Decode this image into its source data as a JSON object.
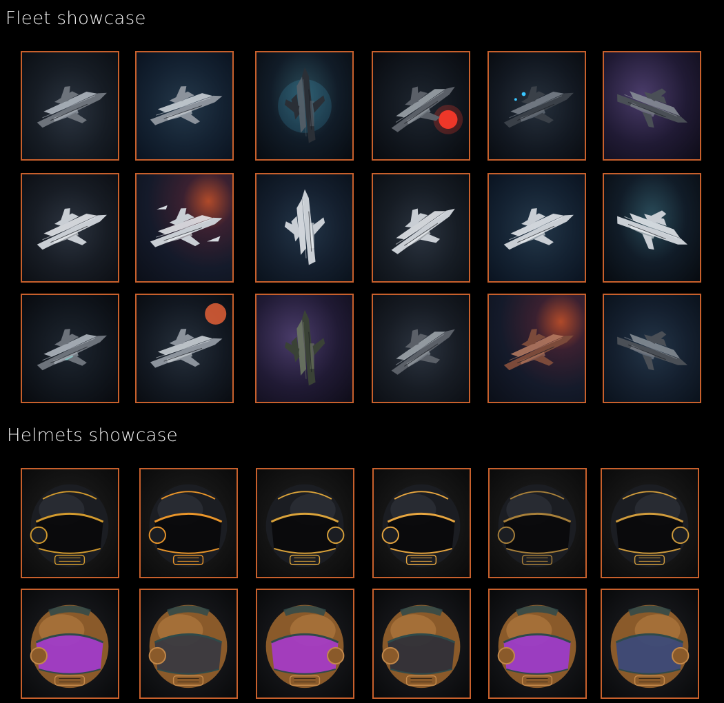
{
  "sections": {
    "fleet": {
      "title": "Fleet showcase"
    },
    "helmets": {
      "title": "Helmets showcase"
    }
  },
  "colors": {
    "background": "#000000",
    "card_border": "#c8602c",
    "title_text": "#f0f0f0"
  },
  "fleet_items": [
    {
      "icon": "spaceship-image",
      "palette": "gray",
      "accent": "#9aa3ad"
    },
    {
      "icon": "spaceship-image",
      "palette": "silver",
      "accent": "#c8ccd2"
    },
    {
      "icon": "spaceship-image",
      "palette": "dark",
      "accent": "#4fd0ff"
    },
    {
      "icon": "spaceship-image",
      "palette": "silver-red-engine",
      "accent": "#ff3a2a"
    },
    {
      "icon": "spaceship-image",
      "palette": "dark-blue-lights",
      "accent": "#39c6ff"
    },
    {
      "icon": "spaceship-image",
      "palette": "charcoal",
      "accent": "#6a717a"
    },
    {
      "icon": "spaceship-image",
      "palette": "white",
      "accent": "#dfe3e8"
    },
    {
      "icon": "spaceship-image",
      "palette": "white-escort",
      "accent": "#e8ecf0"
    },
    {
      "icon": "spaceship-image",
      "palette": "pale-blue-gold",
      "accent": "#c9a247"
    },
    {
      "icon": "spaceship-image",
      "palette": "white",
      "accent": "#e0e4e8"
    },
    {
      "icon": "spaceship-image",
      "palette": "white",
      "accent": "#d6dade"
    },
    {
      "icon": "spaceship-image",
      "palette": "pale-blue",
      "accent": "#cfd9e2"
    },
    {
      "icon": "spaceship-image",
      "palette": "dark-teal-glow",
      "accent": "#3ee0d0"
    },
    {
      "icon": "spaceship-image",
      "palette": "tan-sunset",
      "accent": "#ff6a3a"
    },
    {
      "icon": "spaceship-image",
      "palette": "green-dark",
      "accent": "#7c8a6c"
    },
    {
      "icon": "spaceship-image",
      "palette": "steel-blue",
      "accent": "#8ea2bb"
    },
    {
      "icon": "spaceship-image",
      "palette": "rust",
      "accent": "#a8644c"
    },
    {
      "icon": "spaceship-image",
      "palette": "charcoal",
      "accent": "#7d848c"
    }
  ],
  "helmet_items": [
    {
      "icon": "helmet-image",
      "palette": "black-gold",
      "accent": "#d29a2e"
    },
    {
      "icon": "helmet-image",
      "palette": "black-amber",
      "accent": "#e9952a"
    },
    {
      "icon": "helmet-image",
      "palette": "black-gold-stripes",
      "accent": "#d9a23a"
    },
    {
      "icon": "helmet-image",
      "palette": "black-gold-visor",
      "accent": "#e7a640"
    },
    {
      "icon": "helmet-image",
      "palette": "dark-gray",
      "accent": "#a8803a"
    },
    {
      "icon": "helmet-image",
      "palette": "black-gold-side",
      "accent": "#cf9b3c"
    },
    {
      "icon": "helmet-image",
      "palette": "bronze-teal-purple",
      "accent": "#a03cc8"
    },
    {
      "icon": "helmet-image",
      "palette": "bronze-teal-dark",
      "accent": "#3a3a40"
    },
    {
      "icon": "helmet-image",
      "palette": "bronze-purple",
      "accent": "#a43cc4"
    },
    {
      "icon": "helmet-image",
      "palette": "bronze-teal-dark",
      "accent": "#303038"
    },
    {
      "icon": "helmet-image",
      "palette": "bronze-teal-purple",
      "accent": "#9c3cc8"
    },
    {
      "icon": "helmet-image",
      "palette": "bronze-teal-blue",
      "accent": "#3c4a78"
    }
  ]
}
